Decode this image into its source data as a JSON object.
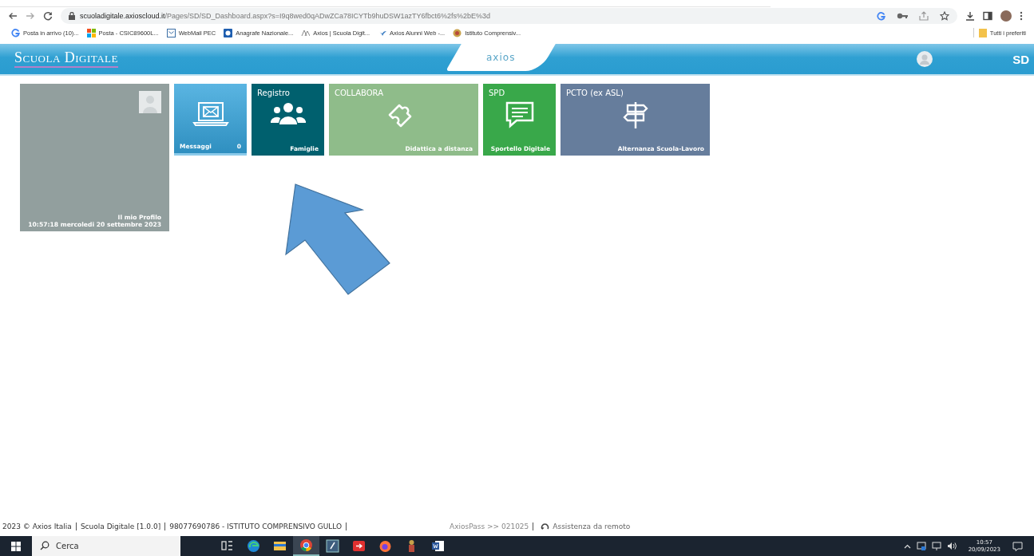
{
  "browser": {
    "url_host": "scuoladigitale.axioscloud.it",
    "url_path": "/Pages/SD/SD_Dashboard.aspx?s=I9q8wed0qADwZCa78ICYTb9huDSW1azTY6fbct6%2fs%2bE%3d",
    "bookmarks": [
      {
        "kind": "google",
        "label": "Posta in arrivo (10)..."
      },
      {
        "kind": "windows",
        "label": "Posta - CSIC89600L..."
      },
      {
        "kind": "mail",
        "label": "WebMail PEC"
      },
      {
        "kind": "square",
        "label": "Anagrafe Nazionale..."
      },
      {
        "kind": "axios",
        "label": "Axios | Scuola Digit..."
      },
      {
        "kind": "bird",
        "label": "Axios Alunni Web -..."
      },
      {
        "kind": "crest",
        "label": "Istituto Comprensiv..."
      }
    ],
    "all_bookmarks": "Tutti i preferiti"
  },
  "header": {
    "title": "Scuola Digitale",
    "logo": "axios",
    "badge": "SD"
  },
  "profile": {
    "label": "Il mio Profilo",
    "datetime": "10:57:18 mercoledi 20 settembre 2023"
  },
  "tiles": [
    {
      "kind": "mail",
      "caption": "Messaggi",
      "count": "0",
      "color": "#2f8fc0",
      "wide": false
    },
    {
      "kind": "people",
      "title": "Registro",
      "caption": "Famiglie",
      "color": "#00606e",
      "wide": false
    },
    {
      "kind": "puzzle",
      "title": "COLLABORA",
      "caption": "Didattica a distanza",
      "color": "#8fbc8a",
      "wide": true
    },
    {
      "kind": "chat",
      "title": "SPD",
      "caption": "Sportello Digitale",
      "color": "#39a84a",
      "wide": false
    },
    {
      "kind": "sign",
      "title": "PCTO (ex ASL)",
      "caption": "Alternanza Scuola-Lavoro",
      "color": "#667d9c",
      "wide": true
    }
  ],
  "footer": {
    "left": [
      "2023 © Axios Italia",
      "Scuola Digitale [1.0.0]",
      "98077690786 - ISTITUTO COMPRENSIVO GULLO"
    ],
    "right": [
      "AxiosPass >> 021025"
    ],
    "support": "Assistenza da remoto"
  },
  "taskbar": {
    "search_placeholder": "Cerca",
    "apps": [
      {
        "kind": "taskview"
      },
      {
        "kind": "edge"
      },
      {
        "kind": "files"
      },
      {
        "kind": "chrome"
      },
      {
        "kind": "editor"
      },
      {
        "kind": "red"
      },
      {
        "kind": "firefox"
      },
      {
        "kind": "figure"
      },
      {
        "kind": "word"
      }
    ],
    "time": "10:57",
    "date": "20/09/2023"
  }
}
